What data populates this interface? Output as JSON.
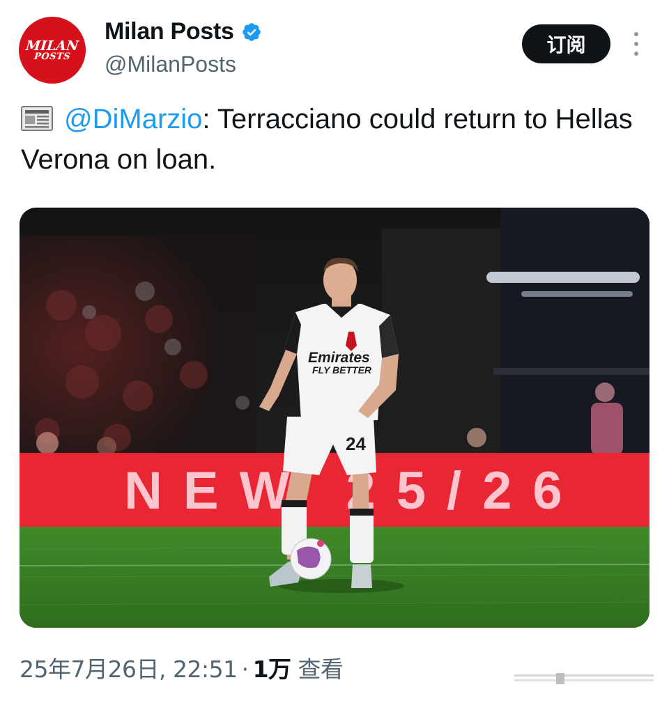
{
  "author": {
    "avatar_text_line1": "MILAN",
    "avatar_text_line2": "POSTS",
    "display_name": "Milan Posts",
    "handle": "@MilanPosts",
    "verified": true
  },
  "actions": {
    "subscribe_label": "订阅"
  },
  "tweet": {
    "icon": "newspaper-icon",
    "mention": "@DiMarzio",
    "text_after_mention": ": Terracciano could return to Hellas Verona on loan."
  },
  "media": {
    "banner_text": "NEW 25/26",
    "jersey_sponsor": "Emirates",
    "jersey_sponsor_sub": "FLY BETTER",
    "jersey_number": "24"
  },
  "footer": {
    "timestamp": "25年7月26日, 22:51",
    "separator": "·",
    "views_count": "1万",
    "views_label": "查看"
  },
  "colors": {
    "mention": "#1d9bf0",
    "avatar_bg": "#d6111c",
    "subscribe_bg": "#0f1419",
    "verified": "#1d9bf0"
  }
}
